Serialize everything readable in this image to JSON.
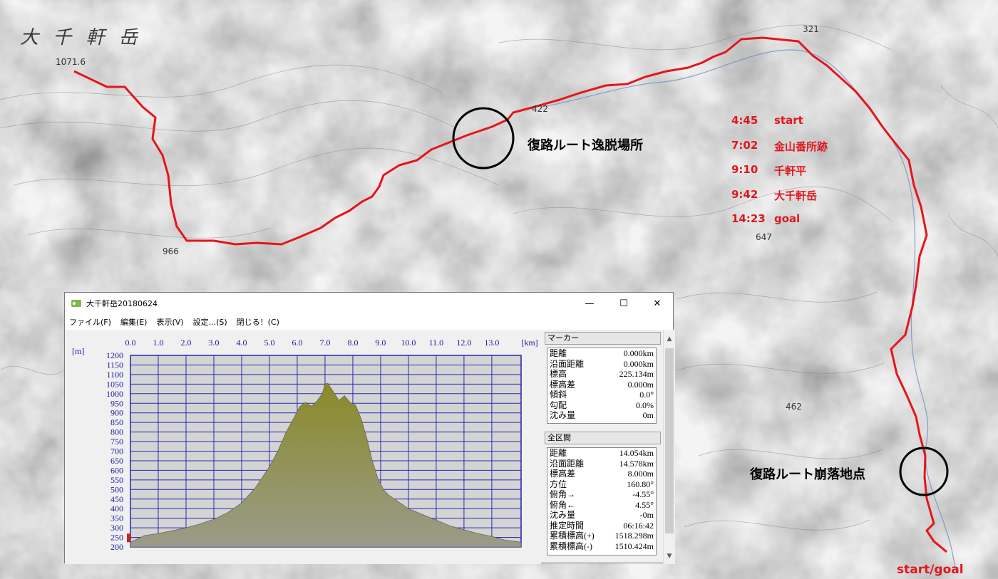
{
  "map": {
    "peak_name": "大 千 軒 岳",
    "spot_elevations": [
      "1071.6",
      "966",
      "422",
      "321",
      "647",
      "462"
    ],
    "route_color": "#e5151b",
    "annotations": {
      "deviation": "復路ルート逸脱場所",
      "collapse": "復路ルート崩落地点",
      "start_goal": "start/goal"
    },
    "timeline": [
      {
        "time": "4:45",
        "label": "start"
      },
      {
        "time": "7:02",
        "label": "金山番所跡"
      },
      {
        "time": "9:10",
        "label": "千軒平"
      },
      {
        "time": "9:42",
        "label": "大千軒岳"
      },
      {
        "time": "14:23",
        "label": "goal"
      }
    ]
  },
  "window": {
    "title": "大千軒岳20180624",
    "controls": {
      "minimize": "—",
      "maximize": "☐",
      "close": "✕"
    },
    "menu": [
      "ファイル(F)",
      "編集(E)",
      "表示(V)",
      "設定...(S)",
      "閉じる！(C)"
    ]
  },
  "chart_data": {
    "type": "area",
    "xlabel": "[km]",
    "ylabel": "[m]",
    "x_ticks": [
      "0.0",
      "1.0",
      "2.0",
      "3.0",
      "4.0",
      "5.0",
      "6.0",
      "7.0",
      "8.0",
      "9.0",
      "10.0",
      "11.0",
      "12.0",
      "13.0"
    ],
    "y_ticks": [
      "1200",
      "1150",
      "1100",
      "1050",
      "1000",
      "950",
      "900",
      "850",
      "800",
      "750",
      "700",
      "650",
      "600",
      "550",
      "500",
      "450",
      "400",
      "350",
      "300",
      "250",
      "200"
    ],
    "xlim": [
      0,
      14.054
    ],
    "ylim": [
      200,
      1200
    ],
    "grid": true,
    "fill_color": "#8a8a33",
    "series": [
      {
        "x": [
          0,
          0.5,
          1.0,
          1.5,
          2.0,
          2.5,
          3.0,
          3.5,
          4.0,
          4.5,
          5.0,
          5.3,
          5.6,
          5.9,
          6.1,
          6.3,
          6.5,
          6.7,
          6.9,
          7.0,
          7.1,
          7.3,
          7.5,
          7.7,
          7.9,
          8.1,
          8.3,
          8.5,
          8.7,
          8.9,
          9.1,
          9.3,
          9.6,
          10.0,
          10.5,
          11.0,
          11.5,
          12.0,
          12.5,
          13.0,
          13.5,
          14.054
        ],
        "y": [
          225,
          260,
          270,
          285,
          300,
          320,
          345,
          380,
          430,
          510,
          620,
          700,
          800,
          880,
          935,
          955,
          935,
          960,
          1000,
          1050,
          1055,
          1010,
          965,
          990,
          955,
          940,
          870,
          770,
          650,
          560,
          500,
          470,
          440,
          400,
          370,
          340,
          310,
          290,
          270,
          255,
          235,
          225
        ]
      }
    ]
  },
  "marker": {
    "header": "マーカー",
    "rows": [
      {
        "k": "距離",
        "v": "0.000km"
      },
      {
        "k": "沿面距離",
        "v": "0.000km"
      },
      {
        "k": "標高",
        "v": "225.134m"
      },
      {
        "k": "標高差",
        "v": "0.000m"
      },
      {
        "k": "傾斜",
        "v": "0.0°"
      },
      {
        "k": "勾配",
        "v": "0.0%"
      },
      {
        "k": "沈み量",
        "v": "0m"
      }
    ]
  },
  "total": {
    "header": "全区間",
    "rows": [
      {
        "k": "距離",
        "v": "14.054km"
      },
      {
        "k": "沿面距離",
        "v": "14.578km"
      },
      {
        "k": "標高差",
        "v": "8.000m"
      },
      {
        "k": "方位",
        "v": "160.80°"
      },
      {
        "k": "俯角→",
        "v": "-4.55°"
      },
      {
        "k": "俯角←",
        "v": "4.55°"
      },
      {
        "k": "沈み量",
        "v": "-0m"
      },
      {
        "k": "推定時間",
        "v": "06:16:42"
      },
      {
        "k": "累積標高(+)",
        "v": "1518.298m"
      },
      {
        "k": "累積標高(-)",
        "v": "1510.424m"
      }
    ]
  }
}
